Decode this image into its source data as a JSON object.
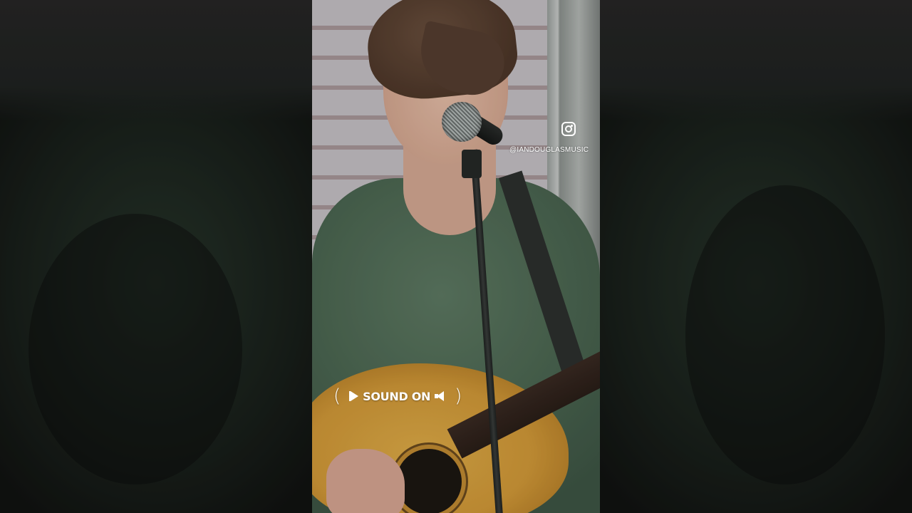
{
  "overlay": {
    "instagram_icon": "instagram-icon",
    "instagram_handle": "@IANDOUGLASMUSIC",
    "sound_on_label": "SOUND ON",
    "sound_on_left_icon": "play-flag-icon",
    "sound_on_right_icon": "speaker-icon",
    "text_color": "#ffffff"
  },
  "colors": {
    "background_blur": "#161a17",
    "shirt": "#4b6651",
    "guitar": "#d39a38"
  }
}
